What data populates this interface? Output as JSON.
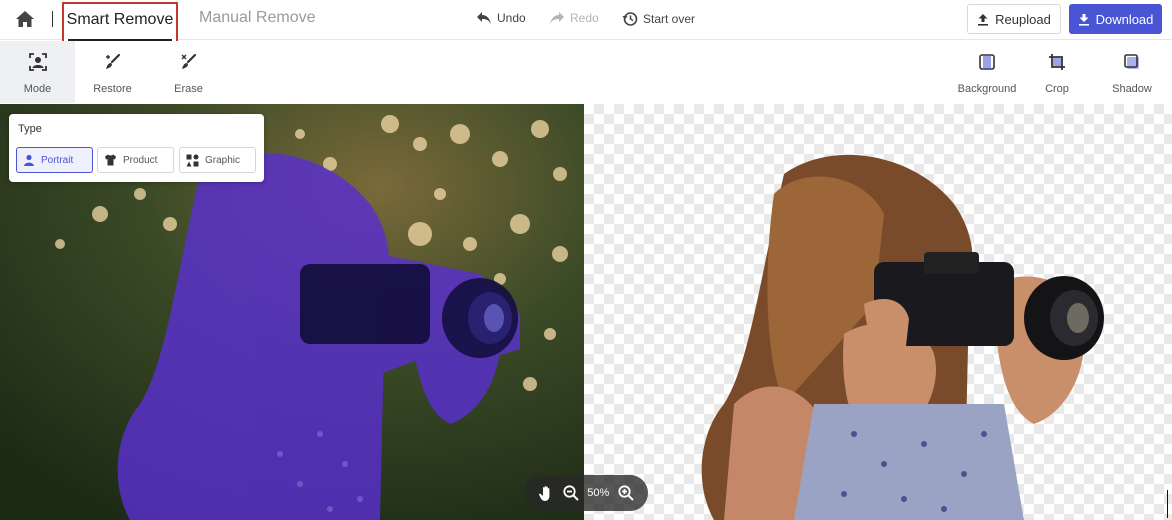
{
  "header": {
    "home_icon": "home-icon",
    "tabs": [
      {
        "label": "Smart Remove",
        "active": true
      },
      {
        "label": "Manual Remove",
        "active": false
      }
    ],
    "history": [
      {
        "label": "Undo",
        "icon": "undo-icon",
        "enabled": true
      },
      {
        "label": "Redo",
        "icon": "redo-icon",
        "enabled": false
      },
      {
        "label": "Start over",
        "icon": "history-icon",
        "enabled": true
      }
    ],
    "reupload_label": "Reupload",
    "download_label": "Download"
  },
  "tools_left": [
    {
      "label": "Mode",
      "icon": "mode-icon",
      "active": true
    },
    {
      "label": "Restore",
      "icon": "restore-brush-icon",
      "active": false
    },
    {
      "label": "Erase",
      "icon": "erase-brush-icon",
      "active": false
    }
  ],
  "tools_right": [
    {
      "label": "Background",
      "icon": "background-icon"
    },
    {
      "label": "Crop",
      "icon": "crop-icon"
    },
    {
      "label": "Shadow",
      "icon": "shadow-icon"
    }
  ],
  "type_panel": {
    "title": "Type",
    "options": [
      {
        "label": "Portrait",
        "icon": "portrait-icon",
        "selected": true
      },
      {
        "label": "Product",
        "icon": "product-shirt-icon",
        "selected": false
      },
      {
        "label": "Graphic",
        "icon": "graphic-icon",
        "selected": false
      }
    ]
  },
  "zoom": {
    "level": "50%"
  },
  "colors": {
    "accent": "#4a55d6",
    "highlight_box": "#c0392b",
    "selection_overlay": "#5a2fd0"
  }
}
